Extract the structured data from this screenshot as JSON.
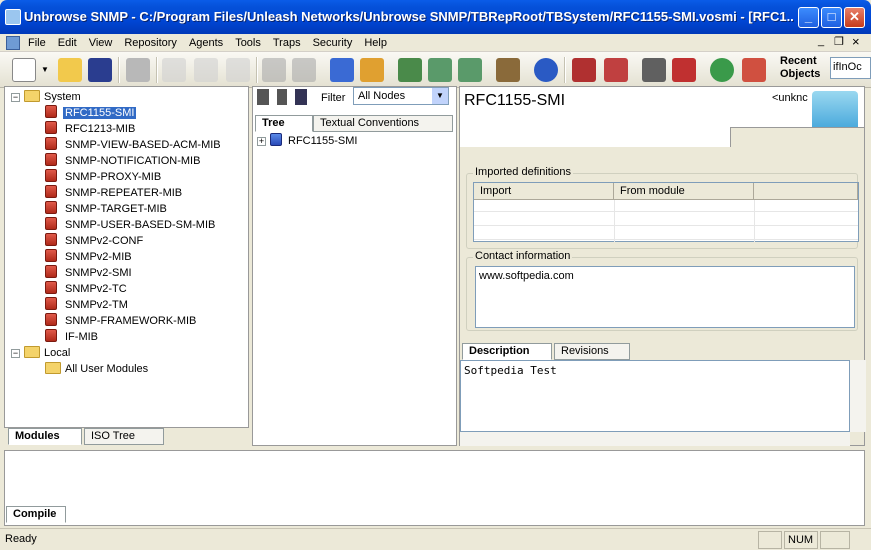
{
  "window": {
    "title": "Unbrowse SNMP  - C:/Program Files/Unleash Networks/Unbrowse SNMP/TBRepRoot/TBSystem/RFC1155-SMI.vosmi - [RFC1...",
    "min": "_",
    "max": "□",
    "close": "✕"
  },
  "menu": [
    "File",
    "Edit",
    "View",
    "Repository",
    "Agents",
    "Tools",
    "Traps",
    "Security",
    "Help"
  ],
  "mdi": {
    "min": "_",
    "restore": "❐",
    "close": "×"
  },
  "toolbar": {
    "recent_label_1": "Recent",
    "recent_label_2": "Objects",
    "recent_value": "ifInOc"
  },
  "left_tree": {
    "system_label": "System",
    "system_items": [
      "RFC1155-SMI",
      "RFC1213-MIB",
      "SNMP-VIEW-BASED-ACM-MIB",
      "SNMP-NOTIFICATION-MIB",
      "SNMP-PROXY-MIB",
      "SNMP-REPEATER-MIB",
      "SNMP-TARGET-MIB",
      "SNMP-USER-BASED-SM-MIB",
      "SNMPv2-CONF",
      "SNMPv2-MIB",
      "SNMPv2-SMI",
      "SNMPv2-TC",
      "SNMPv2-TM",
      "SNMP-FRAMEWORK-MIB",
      "IF-MIB"
    ],
    "local_label": "Local",
    "local_items": [
      "All User Modules"
    ],
    "selected": "RFC1155-SMI"
  },
  "left_tabs": [
    "Modules",
    "ISO Tree"
  ],
  "middle": {
    "filter_label": "Filter",
    "filter_value": "All Nodes",
    "tabs": [
      "Tree",
      "Textual Conventions"
    ],
    "tree_root": "RFC1155-SMI"
  },
  "right": {
    "module_title": "RFC1155-SMI",
    "unknown_label": "<unknc",
    "imported_group": "Imported definitions",
    "columns": [
      "Import",
      "From module"
    ],
    "contact_group": "Contact information",
    "contact_text": "www.softpedia.com",
    "desc_tabs": [
      "Description",
      "Revisions"
    ],
    "description_text": "Softpedia Test"
  },
  "bottom": {
    "tab": "Compile"
  },
  "status": {
    "text": "Ready",
    "num": "NUM"
  }
}
